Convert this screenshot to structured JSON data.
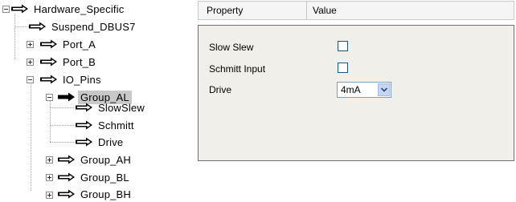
{
  "tree": {
    "items": [
      {
        "label": "Hardware_Specific",
        "expander": "minus",
        "selected": false
      },
      {
        "label": "Suspend_DBUS7",
        "expander": null,
        "selected": false
      },
      {
        "label": "Port_A",
        "expander": "plus",
        "selected": false
      },
      {
        "label": "Port_B",
        "expander": "plus",
        "selected": false
      },
      {
        "label": "IO_Pins",
        "expander": "minus",
        "selected": false
      },
      {
        "label": "Group_AL",
        "expander": "minus",
        "selected": true
      },
      {
        "label": "SlowSlew",
        "expander": null,
        "selected": false
      },
      {
        "label": "Schmitt",
        "expander": null,
        "selected": false
      },
      {
        "label": "Drive",
        "expander": null,
        "selected": false
      },
      {
        "label": "Group_AH",
        "expander": "plus",
        "selected": false
      },
      {
        "label": "Group_BL",
        "expander": "plus",
        "selected": false
      },
      {
        "label": "Group_BH",
        "expander": "plus",
        "selected": false
      }
    ]
  },
  "grid": {
    "header": {
      "property": "Property",
      "value": "Value"
    },
    "rows": [
      {
        "label": "Slow Slew",
        "type": "checkbox",
        "checked": false
      },
      {
        "label": "Schmitt Input",
        "type": "checkbox",
        "checked": false
      },
      {
        "label": "Drive",
        "type": "select",
        "value": "4mA"
      }
    ]
  },
  "icons": {
    "node_arrow": "right-arrow-icon",
    "expander": "tree-expander-icon",
    "dropdown": "chevron-down-icon"
  },
  "colors": {
    "selection": "#c8c8c8",
    "panel_bg": "#f1efe9",
    "dropdown_button": "#c6d6f5"
  }
}
